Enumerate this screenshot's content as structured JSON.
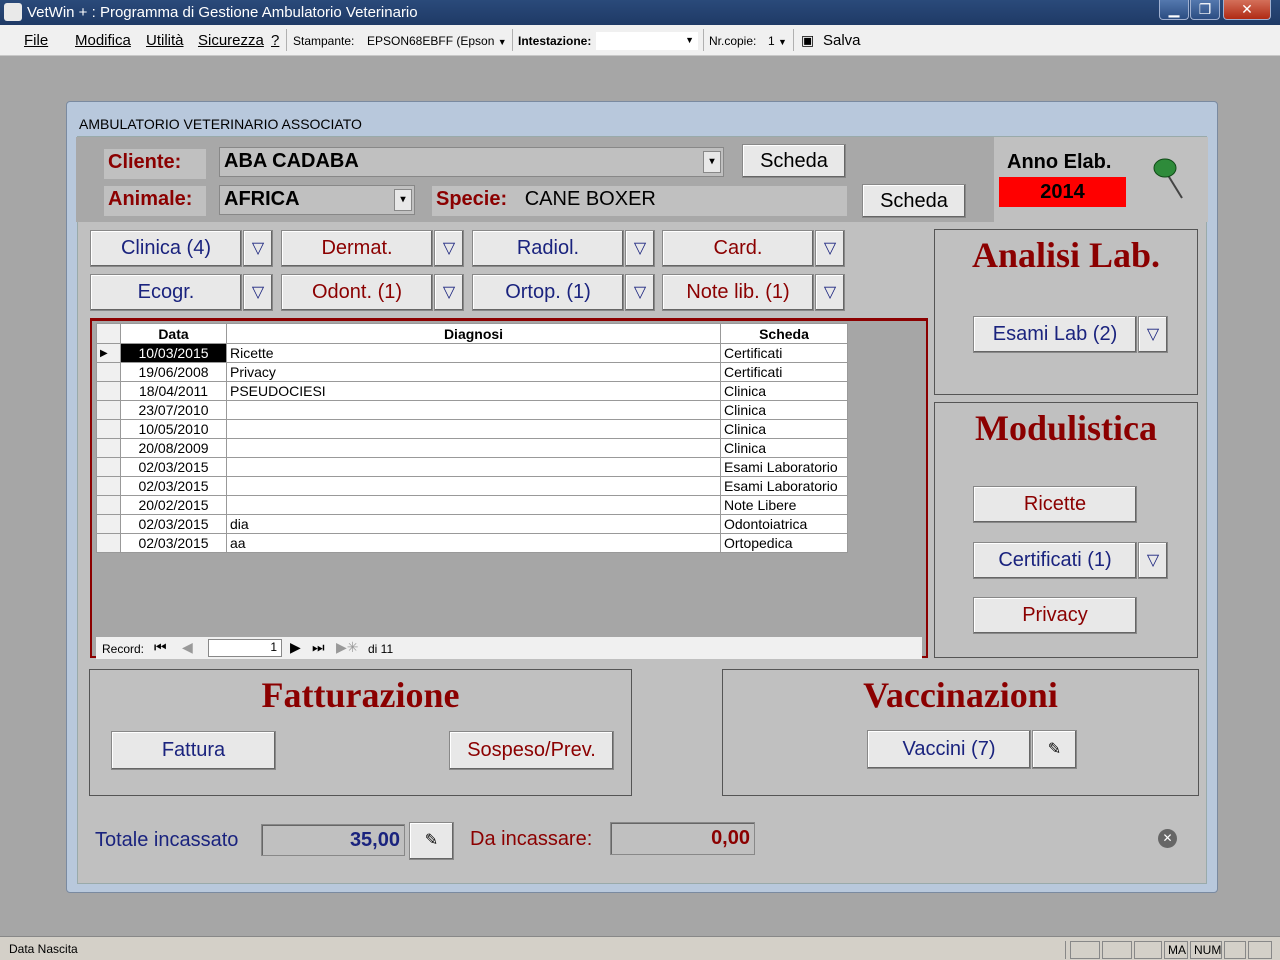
{
  "window": {
    "title": "VetWin + : Programma di Gestione Ambulatorio Veterinario"
  },
  "menu": {
    "file": "File",
    "modifica": "Modifica",
    "utilita": "Utilità",
    "sicurezza": "Sicurezza",
    "help": "?",
    "stampante_label": "Stampante:",
    "stampante_value": "EPSON68EBFF (Epson",
    "intestazione_label": "Intestazione:",
    "intestazione_value": "",
    "nrcopie_label": "Nr.copie:",
    "nrcopie_value": "1",
    "salva": "Salva"
  },
  "form": {
    "title": "AMBULATORIO VETERINARIO ASSOCIATO",
    "cliente_label": "Cliente:",
    "cliente_value": "ABA CADABA",
    "scheda1": "Scheda",
    "animale_label": "Animale:",
    "animale_value": "AFRICA",
    "specie_label": "Specie:",
    "specie_value": "CANE  BOXER",
    "scheda2": "Scheda",
    "anno_label": "Anno Elab.",
    "anno_value": "2014"
  },
  "categories": {
    "clinica": "Clinica (4)",
    "dermat": "Dermat.",
    "radiol": "Radiol.",
    "card": "Card.",
    "ecogr": "Ecogr.",
    "odont": "Odont. (1)",
    "ortop": "Ortop. (1)",
    "notelib": "Note lib. (1)"
  },
  "grid": {
    "columns": [
      "Data",
      "Diagnosi",
      "Scheda"
    ],
    "rows": [
      [
        "10/03/2015",
        "Ricette",
        "Certificati"
      ],
      [
        "19/06/2008",
        "Privacy",
        "Certificati"
      ],
      [
        "18/04/2011",
        "PSEUDOCIESI",
        "Clinica"
      ],
      [
        "23/07/2010",
        "",
        "Clinica"
      ],
      [
        "10/05/2010",
        "",
        "Clinica"
      ],
      [
        "20/08/2009",
        "",
        "Clinica"
      ],
      [
        "02/03/2015",
        "",
        "Esami Laboratorio"
      ],
      [
        "02/03/2015",
        "",
        "Esami Laboratorio"
      ],
      [
        "20/02/2015",
        "",
        "Note Libere"
      ],
      [
        "02/03/2015",
        "dia",
        "Odontoiatrica"
      ],
      [
        "02/03/2015",
        "aa",
        "Ortopedica"
      ]
    ],
    "record_label": "Record:",
    "record_current": "1",
    "record_total": "di 11"
  },
  "analisi": {
    "title": "Analisi Lab.",
    "esami": "Esami Lab (2)"
  },
  "modulistica": {
    "title": "Modulistica",
    "ricette": "Ricette",
    "certificati": "Certificati (1)",
    "privacy": "Privacy"
  },
  "fatturazione": {
    "title": "Fatturazione",
    "fattura": "Fattura",
    "sospeso": "Sospeso/Prev."
  },
  "vaccinazioni": {
    "title": "Vaccinazioni",
    "vaccini": "Vaccini (7)"
  },
  "totali": {
    "totale_label": "Totale incassato",
    "totale_value": "35,00",
    "da_label": "Da incassare:",
    "da_value": "0,00"
  },
  "status": {
    "text": "Data Nascita",
    "ma": "MA",
    "num": "NUM"
  }
}
